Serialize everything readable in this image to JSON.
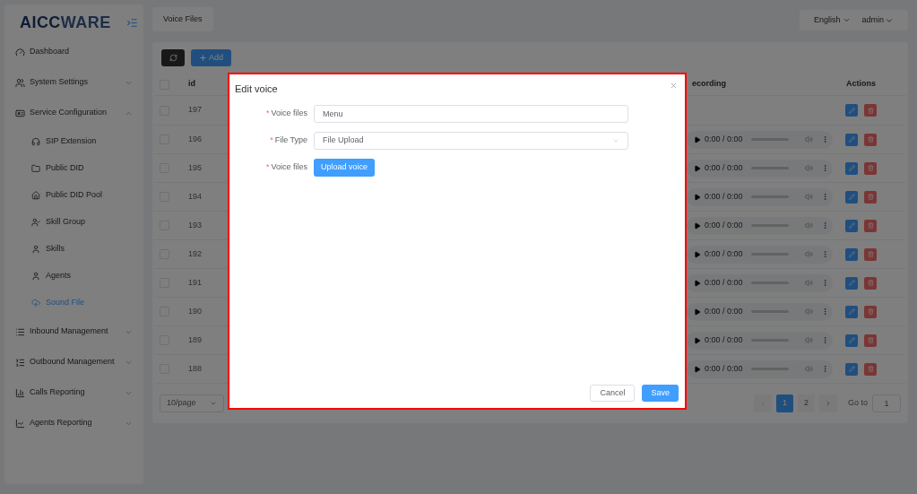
{
  "top_bar": {
    "tab": "Voice Files",
    "language": "English",
    "user": "admin"
  },
  "sidebar": {
    "logo": {
      "part_1": "AICC",
      "part_2": "WARE"
    },
    "items": [
      {
        "label": "Dashboard",
        "selected": false
      },
      {
        "label": "System Settings",
        "selected": false,
        "expanded": false
      },
      {
        "label": "Service Configuration",
        "selected": false,
        "expanded": true,
        "children": [
          {
            "label": "SIP Extension",
            "selected": false
          },
          {
            "label": "Public DID",
            "selected": false
          },
          {
            "label": "Public DID Pool",
            "selected": false
          },
          {
            "label": "Skill Group",
            "selected": false
          },
          {
            "label": "Skills",
            "selected": false
          },
          {
            "label": "Agents",
            "selected": false
          },
          {
            "label": "Sound File",
            "selected": true
          }
        ]
      },
      {
        "label": "Inbound Management",
        "selected": false,
        "expanded": false
      },
      {
        "label": "Outbound Management",
        "selected": false,
        "expanded": false
      },
      {
        "label": "Calls Reporting",
        "selected": false,
        "expanded": false
      },
      {
        "label": "Agents Reporting",
        "selected": false,
        "expanded": false
      }
    ]
  },
  "toolbar": {
    "add_button": "Add"
  },
  "table": {
    "all_checked": false,
    "columns": {
      "id": "id",
      "recording": "ecording",
      "actions": "Actions"
    },
    "rows": [
      {
        "id": "197",
        "checked": false,
        "kind": "none"
      },
      {
        "id": "196",
        "checked": false,
        "kind": "player",
        "time": "0:00 / 0:00"
      },
      {
        "id": "195",
        "checked": false,
        "kind": "player",
        "time": "0:00 / 0:00"
      },
      {
        "id": "194",
        "checked": false,
        "kind": "player",
        "time": "0:00 / 0:00"
      },
      {
        "id": "193",
        "checked": false,
        "kind": "player",
        "time": "0:00 / 0:00"
      },
      {
        "id": "192",
        "checked": false,
        "kind": "player",
        "time": "0:00 / 0:00"
      },
      {
        "id": "191",
        "checked": false,
        "kind": "player",
        "time": "0:00 / 0:00"
      },
      {
        "id": "190",
        "checked": false,
        "kind": "player",
        "time": "0:00 / 0:00"
      },
      {
        "id": "189",
        "checked": false,
        "kind": "player",
        "time": "0:00 / 0:00"
      },
      {
        "id": "188",
        "checked": false,
        "kind": "player",
        "time": "0:00 / 0:00"
      }
    ]
  },
  "pagination": {
    "page_size": "10/page",
    "pages": [
      {
        "label": "1",
        "selected": true
      },
      {
        "label": "2",
        "selected": false
      }
    ],
    "goto_label": "Go to",
    "goto_value": "1"
  },
  "modal": {
    "title": "Edit voice",
    "fields": [
      {
        "kind": "input",
        "mark": "*",
        "label": "Voice files",
        "value": "Menu"
      },
      {
        "kind": "select",
        "mark": "*",
        "label": "File Type",
        "value": "File Upload"
      },
      {
        "kind": "upload",
        "mark": "*",
        "label": "Voice files",
        "button": "Upload voice"
      }
    ],
    "buttons": [
      {
        "kind": "default",
        "label": "Cancel"
      },
      {
        "kind": "primary",
        "label": "Save"
      }
    ]
  }
}
